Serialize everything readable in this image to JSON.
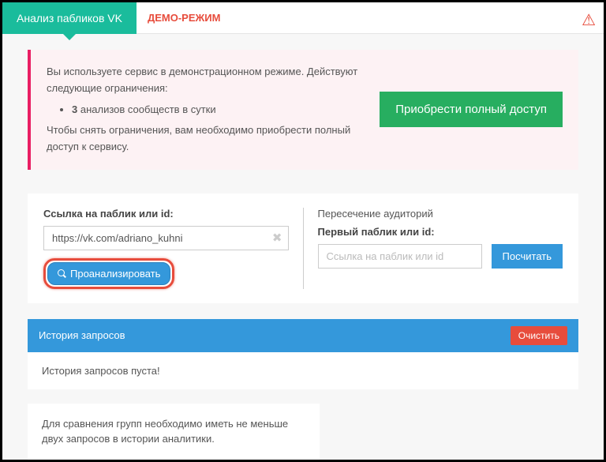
{
  "tabs": {
    "active": "Анализ пабликов VK",
    "demo": "ДЕМО-РЕЖИМ"
  },
  "alert": {
    "line1": "Вы используете сервис в демонстрационном режиме. Действуют следующие ограничения:",
    "bullet_count": "3",
    "bullet_text": " анализов сообществ в сутки",
    "line2": "Чтобы снять ограничения, вам необходимо приобрести полный доступ к сервису.",
    "cta": "Приобрести полный доступ"
  },
  "analyze": {
    "label": "Ссылка на паблик или id:",
    "value": "https://vk.com/adriano_kuhni",
    "button": "Проанализировать"
  },
  "intersect": {
    "heading": "Пересечение аудиторий",
    "label": "Первый паблик или id:",
    "placeholder": "Ссылка на паблик или id",
    "button": "Посчитать"
  },
  "history": {
    "title": "История запросов",
    "clear": "Очистить",
    "empty": "История запросов пуста!"
  },
  "footer_note": "Для сравнения групп необходимо иметь не меньше двух запросов в истории аналитики."
}
